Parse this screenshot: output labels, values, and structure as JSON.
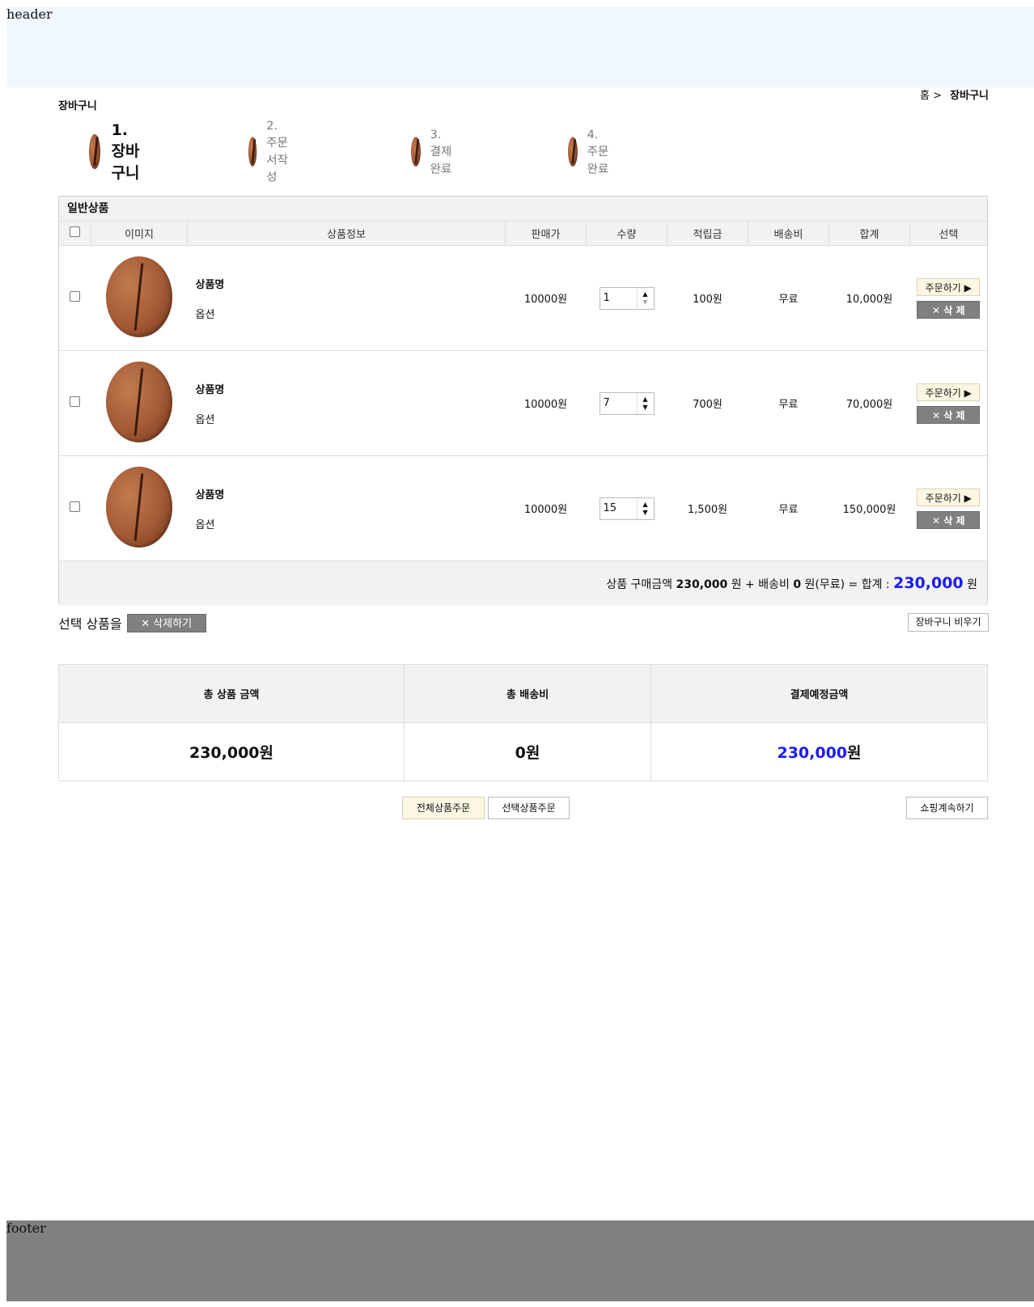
{
  "header": {
    "label": "header"
  },
  "footer": {
    "label": "footer"
  },
  "page_title": "장바구니",
  "breadcrumb": {
    "home": "홈 >",
    "current": "장바구니"
  },
  "steps": [
    {
      "label": "1. 장바구니",
      "active": true
    },
    {
      "label": "2. 주문서작성",
      "active": false
    },
    {
      "label": "3. 결제완료",
      "active": false
    },
    {
      "label": "4. 주문완료",
      "active": false
    }
  ],
  "cart": {
    "section_title": "일반상품",
    "columns": [
      "이미지",
      "상품정보",
      "판매가",
      "수량",
      "적립금",
      "배송비",
      "합계",
      "선택"
    ],
    "rows": [
      {
        "name": "상품명",
        "option": "옵션",
        "price": "10000원",
        "qty": "1",
        "points": "100원",
        "shipping": "무료",
        "total": "10,000원"
      },
      {
        "name": "상품명",
        "option": "옵션",
        "price": "10000원",
        "qty": "7",
        "points": "700원",
        "shipping": "무료",
        "total": "70,000원"
      },
      {
        "name": "상품명",
        "option": "옵션",
        "price": "10000원",
        "qty": "15",
        "points": "1,500원",
        "shipping": "무료",
        "total": "150,000원"
      }
    ],
    "order_btn": "주문하기 ▶",
    "delete_btn": "✕ 삭 제",
    "total_line": {
      "label1": "상품 구매금액",
      "amount": "230,000",
      "label2": "원 + 배송비",
      "shipping": "0",
      "label3": "원(무료) = 합계 :",
      "grand": "230,000",
      "unit": "원"
    }
  },
  "selection": {
    "text": "선택 상품을",
    "delete_btn": "✕ 삭제하기",
    "empty_btn": "장바구니 비우기"
  },
  "summary": {
    "headers": [
      "총 상품 금액",
      "총 배송비",
      "결제예정금액"
    ],
    "product_total": "230,000원",
    "shipping_total": "0원",
    "pay_amount": "230,000",
    "pay_unit": "원"
  },
  "buttons": {
    "order_all": "전체상품주문",
    "order_selected": "선택상품주문",
    "continue_shopping": "쇼핑계속하기"
  },
  "colors": {
    "accent_blue": "#1a1aff",
    "header_bg": "#f1f7ff",
    "footer_bg": "#808080"
  }
}
